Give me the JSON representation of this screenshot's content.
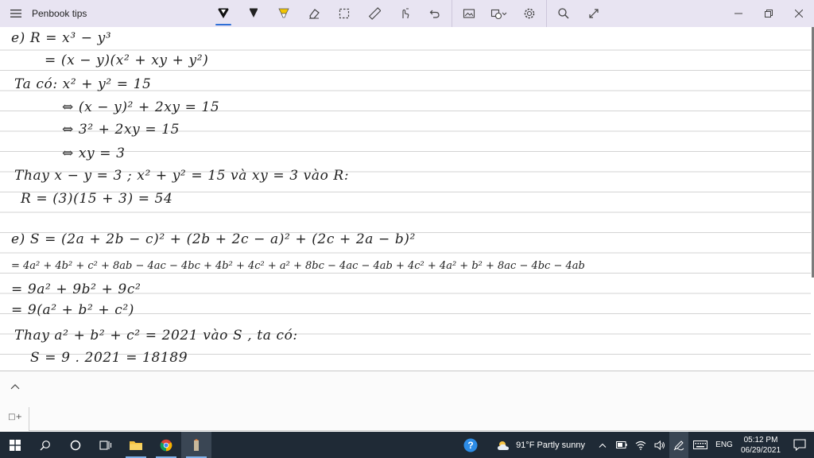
{
  "window": {
    "title": "Penbook tips"
  },
  "toolbar": {
    "tools": [
      {
        "name": "ballpoint-pen-icon",
        "active": true
      },
      {
        "name": "pencil-icon",
        "active": false
      },
      {
        "name": "highlighter-icon",
        "active": false
      },
      {
        "name": "eraser-icon",
        "active": false
      },
      {
        "name": "lasso-select-icon",
        "active": false
      },
      {
        "name": "ruler-icon",
        "active": false
      },
      {
        "name": "touch-writing-icon",
        "active": false
      },
      {
        "name": "undo-icon",
        "active": false
      },
      {
        "name": "insert-image-icon",
        "active": false
      },
      {
        "name": "shapes-icon",
        "active": false
      },
      {
        "name": "settings-gear-icon",
        "active": false
      },
      {
        "name": "search-icon",
        "active": false
      },
      {
        "name": "fullscreen-icon",
        "active": false
      }
    ],
    "accent": "#2f6fd6",
    "pen_colors": {
      "pen": "#111111",
      "pencil": "#222222",
      "highlighter": "#f2c500"
    }
  },
  "notes": {
    "lines": [
      "e) R = x³ − y³",
      "= (x − y)(x² + xy + y²)",
      "Ta có: x² + y² = 15",
      "⇔ (x − y)² + 2xy = 15",
      "⇔ 3² + 2xy = 15",
      "⇔ xy = 3",
      "Thay x − y = 3 ; x² + y² = 15 và xy = 3 vào R:",
      "R = (3)(15 + 3) = 54",
      "e) S = (2a + 2b − c)² + (2b + 2c − a)² + (2c + 2a − b)²",
      "= 4a² + 4b² + c² + 8ab − 4ac − 4bc + 4b² + 4c² + a² + 8bc − 4ac − 4ab + 4c² + 4a² + b² + 8ac − 4bc − 4ab",
      "= 9a² + 9b² + 9c²",
      "= 9(a² + b² + c²)",
      "Thay a² + b² + c² = 2021 vào S , ta có:",
      "S = 9 . 2021 = 18189"
    ]
  },
  "lower_panel": {
    "page_button_label": "□+"
  },
  "taskbar": {
    "apps": [
      {
        "name": "start-icon",
        "open": false
      },
      {
        "name": "search-icon",
        "open": false
      },
      {
        "name": "cortana-icon",
        "open": false
      },
      {
        "name": "task-view-icon",
        "open": false
      },
      {
        "name": "file-explorer-icon",
        "open": true
      },
      {
        "name": "chrome-icon",
        "open": true
      },
      {
        "name": "penbook-app-icon",
        "open": true,
        "current": true
      }
    ],
    "weather": "91°F  Partly sunny",
    "language": "ENG",
    "time": "05:12 PM",
    "date": "06/29/2021"
  }
}
